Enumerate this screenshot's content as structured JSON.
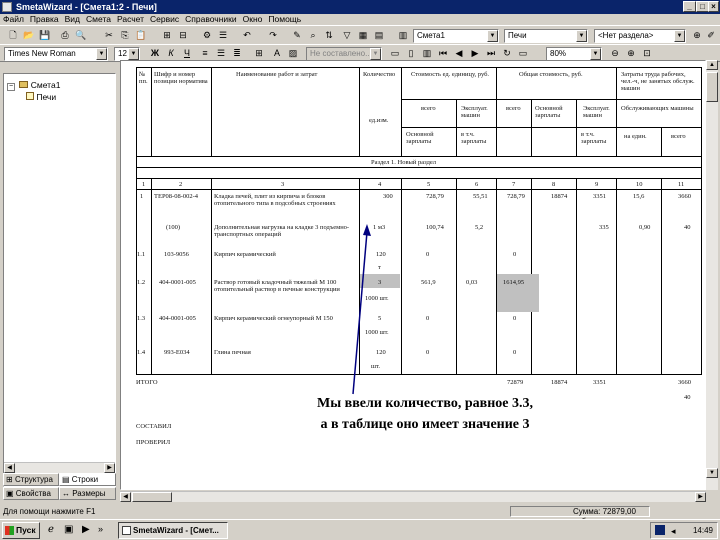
{
  "window": {
    "title": "SmetaWizard - [Смета1:2 - Печи]"
  },
  "menu": [
    "Файл",
    "Правка",
    "Вид",
    "Смета",
    "Расчет",
    "Сервис",
    "Справочники",
    "Окно",
    "Помощь"
  ],
  "toolbar": {
    "smeta_combo": "Смета1",
    "section_combo": "Печи",
    "razdel_combo": "<Нет раздела>",
    "font_combo": "Times New Roman",
    "size_combo": "12",
    "bold_glyph": "Ж",
    "italic_glyph": "К",
    "underline_glyph": "Ч",
    "style_combo": "Не составлено...",
    "zoom_combo": "80%"
  },
  "tree": {
    "root": "Смета1",
    "child": "Печи"
  },
  "tabs": {
    "structure": "Структура",
    "rows": "Строки",
    "properties": "Свойства",
    "sizes": "Размеры"
  },
  "table": {
    "headers": {
      "num": "№ пп.",
      "code": "Шифр и номер позиции норматива",
      "name": "Наименование работ и затрат",
      "qty": "Количество",
      "unit_cost": "Стоимость ед. единицу, руб.",
      "total_cost": "Общая стоимость, руб.",
      "labor": "Затраты труда рабочих, чел.-ч, не занятых обслуж. машин",
      "unit_measure": "ед.изм.",
      "all": "всего",
      "machines": "Эксплуат. машин",
      "all2": "всего",
      "basic_salary": "Основной зарплаты",
      "machines2": "Эксплуат. машин",
      "operating": "Обслуживающих машины",
      "incl_salary": "Основной зарплаты",
      "incl_salary2": "в т.ч. зарплаты",
      "incl_salary3": "в т.ч. зарплаты",
      "per_unit": "на един.",
      "total": "всего",
      "section": "Раздел 1. Новый раздел"
    },
    "col_numbers": [
      "1",
      "2",
      "3",
      "4",
      "5",
      "6",
      "7",
      "8",
      "9",
      "10",
      "11"
    ],
    "rows": [
      {
        "num": "1",
        "code": "ТЕР08-08-002-4",
        "name": "Кладка печей, плит из кирпича и блоков отопительного типа в подсобных строениях",
        "qty": "300",
        "c5": "728,79",
        "c6": "55,51",
        "c7": "728,79",
        "c8": "18874",
        "c9": "3351",
        "c10": "15,6",
        "c11": "3660"
      },
      {
        "num": "",
        "code": "(100)",
        "name": "Дополнительная нагрузка на кладке 3 подъемно-транспортных операций",
        "qty": "1 м3",
        "c5": "100,74",
        "c6": "5,2",
        "c7": "",
        "c8": "",
        "c9": "335",
        "c10": "0,90",
        "c11": "40"
      },
      {
        "num": "1.1",
        "code": "103-9056",
        "name": "Кирпич керамический",
        "qty": "120",
        "c5": "0",
        "c6": "",
        "c7": "0",
        "c8": "",
        "c9": "",
        "c10": "",
        "c11": ""
      },
      {
        "num": "",
        "code": "",
        "name": "",
        "qty": "т",
        "c5": "",
        "c6": "",
        "c7": "",
        "c8": "",
        "c9": "",
        "c10": "",
        "c11": ""
      },
      {
        "num": "1.2",
        "code": "404-0001-005",
        "name": "Раствор готовый кладочный тяжелый М 100 отопительный раствор в печные конструкции",
        "qty": "3",
        "c5": "561,9",
        "c6": "0,03",
        "c7": "1614,95",
        "c8": "",
        "c9": "",
        "c10": "",
        "c11": ""
      },
      {
        "num": "",
        "code": "",
        "name": "",
        "qty": "1000 шт.",
        "c5": "",
        "c6": "",
        "c7": "",
        "c8": "",
        "c9": "",
        "c10": "",
        "c11": ""
      },
      {
        "num": "1.3",
        "code": "404-0001-005",
        "name": "Кирпич керамический огнеупорный М 150",
        "qty": "5",
        "c5": "0",
        "c6": "",
        "c7": "0",
        "c8": "",
        "c9": "",
        "c10": "",
        "c11": ""
      },
      {
        "num": "",
        "code": "",
        "name": "",
        "qty": "1000 шт.",
        "c5": "",
        "c6": "",
        "c7": "",
        "c8": "",
        "c9": "",
        "c10": "",
        "c11": ""
      },
      {
        "num": "1.4",
        "code": "993-Е034",
        "name": "Глина печная",
        "qty": "120",
        "c5": "0",
        "c6": "",
        "c7": "0",
        "c8": "",
        "c9": "",
        "c10": "",
        "c11": ""
      },
      {
        "num": "",
        "code": "",
        "name": "",
        "qty": "шт.",
        "c5": "",
        "c6": "",
        "c7": "",
        "c8": "",
        "c9": "",
        "c10": "",
        "c11": ""
      }
    ],
    "totals": {
      "label": "ИТОГО",
      "c7": "72879",
      "c8": "18874",
      "c9": "3351",
      "c11": "3660",
      "c11b": "40"
    },
    "footer": {
      "compiled": "СОСТАВИЛ",
      "checked": "ПРОВЕРИЛ"
    }
  },
  "callout": {
    "line1": "Мы ввели количество, равное 3.3,",
    "line2": "а в таблице оно имеет значение 3"
  },
  "status": {
    "left": "Для помощи нажмите F1",
    "right": "Сумма: 72879,00 руб."
  },
  "taskbar": {
    "start": "Пуск",
    "task": "SmetaWizard - [Смет...",
    "clock": "14:49"
  }
}
